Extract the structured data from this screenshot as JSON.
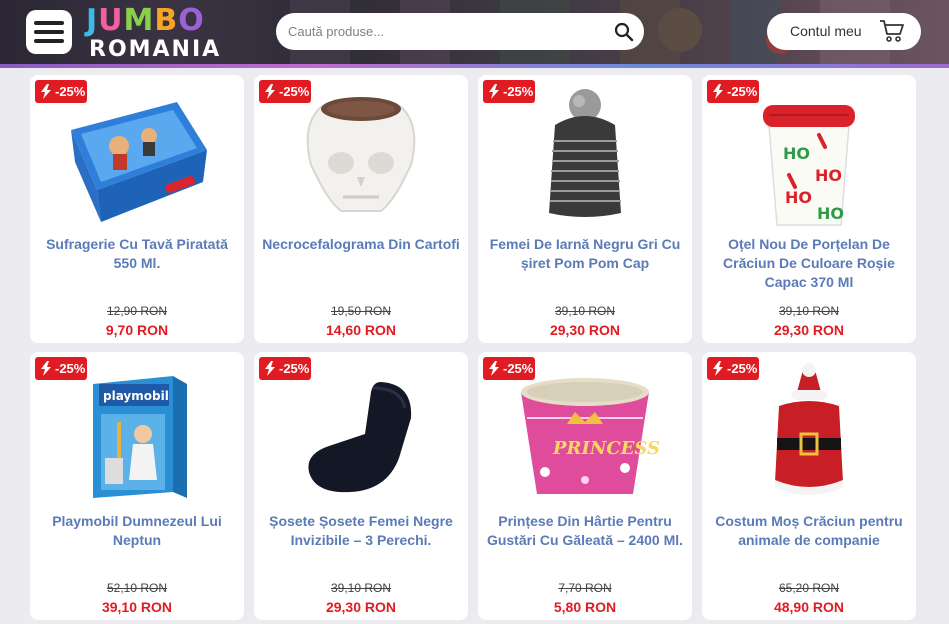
{
  "header": {
    "logo_line1": "JUMBO",
    "logo_line2": "ROMANIA",
    "search_placeholder": "Caută produse...",
    "account_label": "Contul meu"
  },
  "colors": {
    "accent_red": "#e11b22",
    "product_title_blue": "#5a7bb8"
  },
  "products": [
    {
      "discount": "-25%",
      "name": "Sufragerie Cu Tavă Piratată 550 Ml.",
      "old_price": "12,90 RON",
      "price": "9,70 RON",
      "image": "blue-lunch-box"
    },
    {
      "discount": "-25%",
      "name": "Necrocefalograma Din Cartofi",
      "old_price": "19,50 RON",
      "price": "14,60 RON",
      "image": "white-skull-pot"
    },
    {
      "discount": "-25%",
      "name": "Femei De Iarnă Negru Gri Cu șiret Pom Pom Cap",
      "old_price": "39,10 RON",
      "price": "29,30 RON",
      "image": "knit-beanie"
    },
    {
      "discount": "-25%",
      "name": "Oțel Nou De Porțelan De Crăciun De Culoare Roșie Capac 370 Ml",
      "old_price": "39,10 RON",
      "price": "29,30 RON",
      "image": "christmas-mug"
    },
    {
      "discount": "-25%",
      "name": "Playmobil Dumnezeul Lui Neptun",
      "old_price": "52,10 RON",
      "price": "39,10 RON",
      "image": "playmobil-box"
    },
    {
      "discount": "-25%",
      "name": "Șosete Șosete Femei Negre Invizibile – 3 Perechi.",
      "old_price": "39,10 RON",
      "price": "29,30 RON",
      "image": "black-sock"
    },
    {
      "discount": "-25%",
      "name": "Prințese Din Hârtie Pentru Gustări Cu Găleată – 2400 Ml.",
      "old_price": "7,70 RON",
      "price": "5,80 RON",
      "image": "princess-bucket"
    },
    {
      "discount": "-25%",
      "name": "Costum Moș Crăciun pentru animale de companie",
      "old_price": "65,20 RON",
      "price": "48,90 RON",
      "image": "santa-pet-costume"
    }
  ]
}
